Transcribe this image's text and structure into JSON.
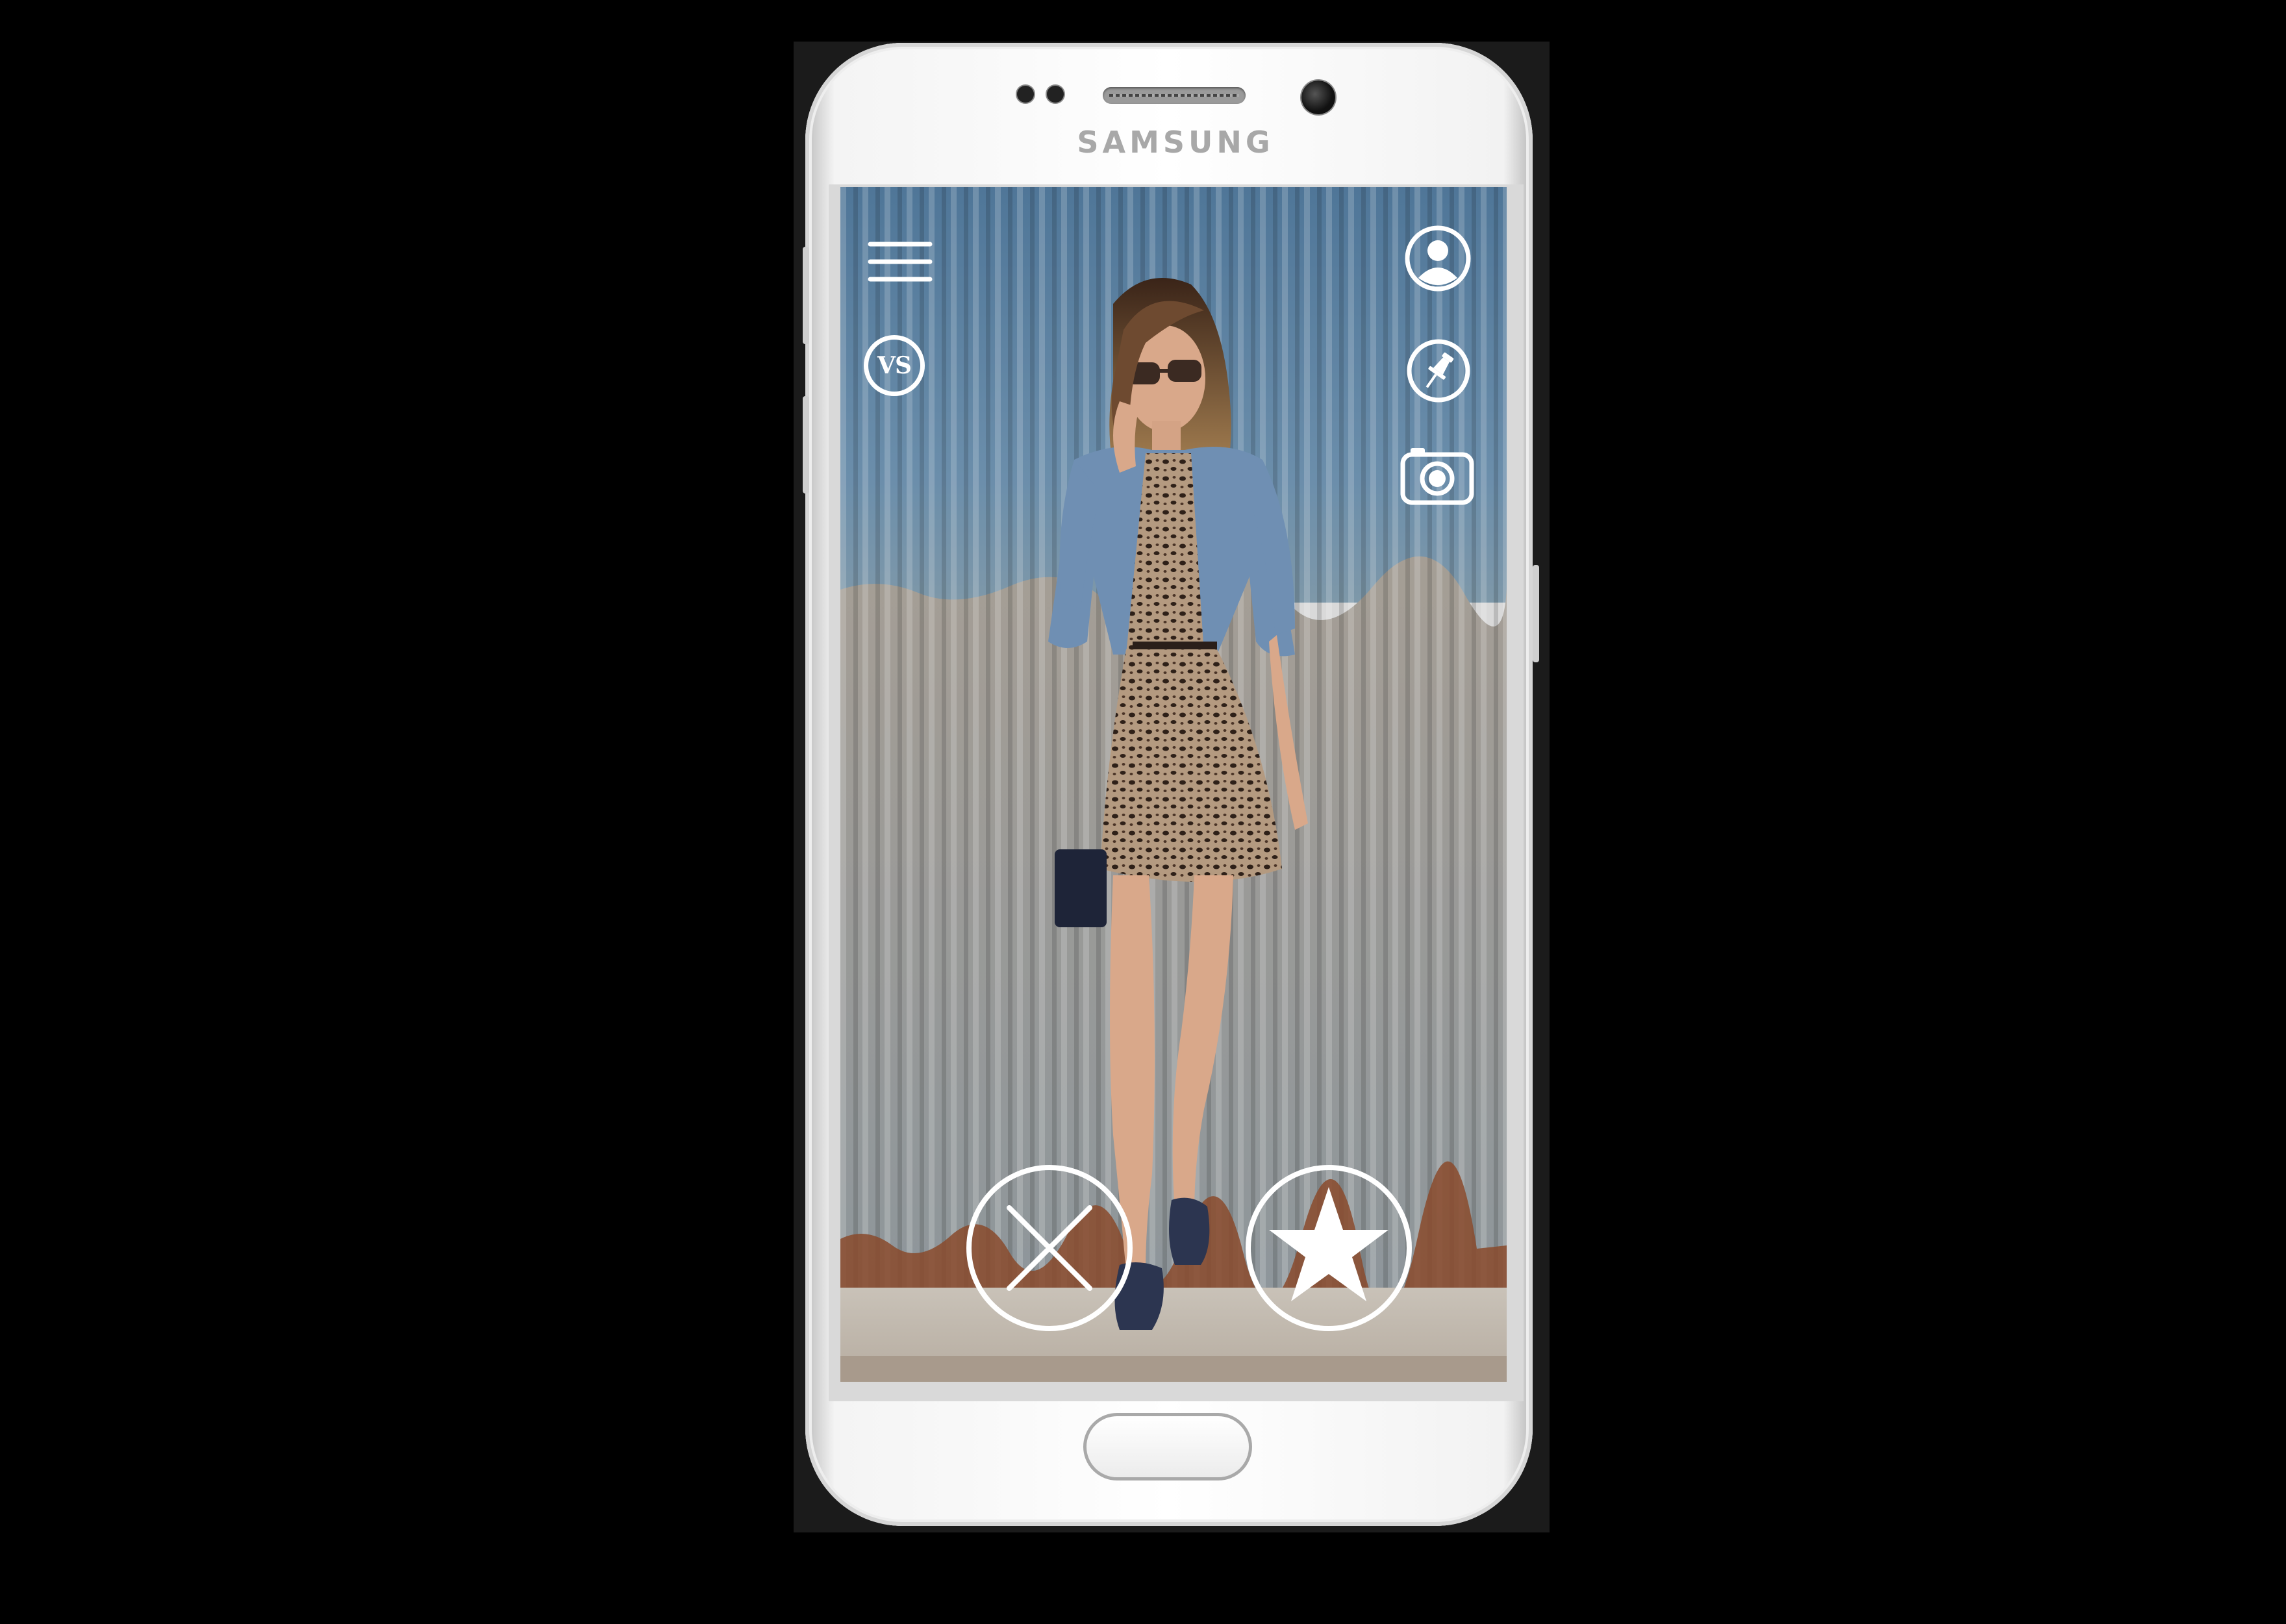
{
  "device": {
    "brand": "SAMSUNG"
  },
  "toolbar": {
    "menu_icon": "hamburger-menu-icon",
    "versus_badge": "VS",
    "profile_icon": "user-profile-icon",
    "pin_icon": "push-pin-icon",
    "camera_icon": "camera-icon"
  },
  "actions": {
    "dislike_icon": "close-x-icon",
    "favorite_icon": "star-icon"
  },
  "colors": {
    "icon_stroke": "#ffffff",
    "background": "#000000",
    "wall_blue": "#5f86a8",
    "wall_gray": "#9aa3a8",
    "rust": "#8a4a2b"
  }
}
